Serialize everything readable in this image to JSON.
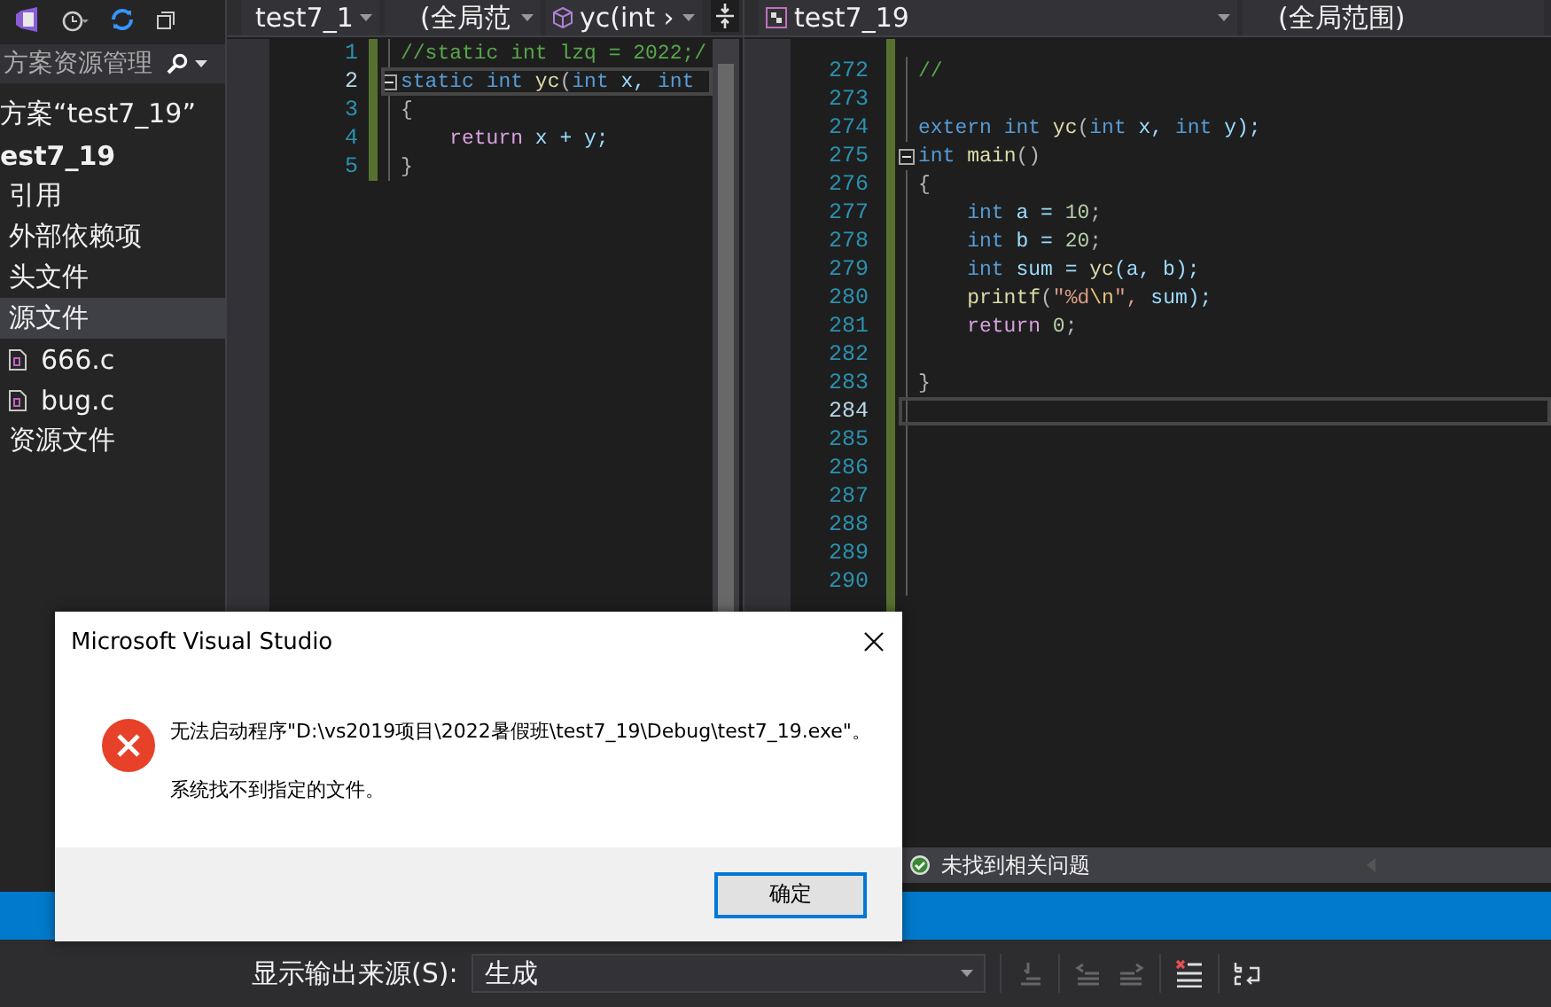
{
  "solution_explorer": {
    "search": {
      "placeholder": "方案资源管理"
    },
    "tree": [
      {
        "label": "方案“test7_19”",
        "kind": "solution",
        "selected": false,
        "children": [
          {
            "label": "est7_19",
            "kind": "project",
            "selected": false,
            "children": [
              {
                "label": "引用",
                "kind": "folder",
                "selected": false
              },
              {
                "label": "外部依赖项",
                "kind": "folder",
                "selected": false
              },
              {
                "label": "头文件",
                "kind": "folder",
                "selected": false
              },
              {
                "label": "源文件",
                "kind": "folder",
                "selected": true,
                "children": [
                  {
                    "label": "666.c",
                    "kind": "file",
                    "selected": false
                  },
                  {
                    "label": "bug.c",
                    "kind": "file",
                    "selected": false
                  }
                ]
              },
              {
                "label": "资源文件",
                "kind": "folder",
                "selected": false
              }
            ]
          }
        ]
      }
    ]
  },
  "left_editor": {
    "file": "test7_1",
    "scope": "(全局范",
    "member": "yc(int ›",
    "lines": [
      {
        "number": "1",
        "fold": false,
        "current": false,
        "tokens": [
          {
            "t": "//static int lzq = 2022;/",
            "kind": "comment"
          }
        ]
      },
      {
        "number": "2",
        "fold": true,
        "current": true,
        "tokens": [
          {
            "t": "static ",
            "kind": "keyword"
          },
          {
            "t": "int ",
            "kind": "keyword"
          },
          {
            "t": "yc",
            "kind": "function"
          },
          {
            "t": "(",
            "kind": "punct"
          },
          {
            "t": "int ",
            "kind": "keyword"
          },
          {
            "t": "x, ",
            "kind": "variable"
          },
          {
            "t": "int",
            "kind": "keyword"
          }
        ]
      },
      {
        "number": "3",
        "fold": false,
        "current": false,
        "tokens": [
          {
            "t": "{",
            "kind": "punct"
          }
        ]
      },
      {
        "number": "4",
        "fold": false,
        "current": false,
        "tokens": [
          {
            "t": "    return ",
            "kind": "control"
          },
          {
            "t": "x + y;",
            "kind": "variable"
          }
        ]
      },
      {
        "number": "5",
        "fold": false,
        "current": false,
        "tokens": [
          {
            "t": "}",
            "kind": "punct"
          }
        ]
      }
    ]
  },
  "right_editor": {
    "file": "test7_19",
    "scope": "(全局范围)",
    "lines": [
      {
        "number": "272",
        "fold": false,
        "current": false,
        "tokens": [
          {
            "t": "//",
            "kind": "comment"
          }
        ]
      },
      {
        "number": "273",
        "fold": false,
        "current": false
      },
      {
        "number": "274",
        "fold": false,
        "current": false,
        "tokens": [
          {
            "t": "extern ",
            "kind": "keyword"
          },
          {
            "t": "int ",
            "kind": "keyword"
          },
          {
            "t": "yc",
            "kind": "function"
          },
          {
            "t": "(",
            "kind": "punct"
          },
          {
            "t": "int ",
            "kind": "keyword"
          },
          {
            "t": "x, ",
            "kind": "variable"
          },
          {
            "t": "int ",
            "kind": "keyword"
          },
          {
            "t": "y);",
            "kind": "variable"
          }
        ]
      },
      {
        "number": "275",
        "fold": true,
        "current": false,
        "tokens": [
          {
            "t": "int ",
            "kind": "keyword"
          },
          {
            "t": "main",
            "kind": "function"
          },
          {
            "t": "()",
            "kind": "punct"
          }
        ]
      },
      {
        "number": "276",
        "fold": false,
        "current": false,
        "tokens": [
          {
            "t": "{",
            "kind": "punct"
          }
        ]
      },
      {
        "number": "277",
        "fold": false,
        "current": false,
        "tokens": [
          {
            "t": "    int ",
            "kind": "keyword"
          },
          {
            "t": "a = ",
            "kind": "variable"
          },
          {
            "t": "10",
            "kind": "number"
          },
          {
            "t": ";",
            "kind": "punct"
          }
        ]
      },
      {
        "number": "278",
        "fold": false,
        "current": false,
        "tokens": [
          {
            "t": "    int ",
            "kind": "keyword"
          },
          {
            "t": "b = ",
            "kind": "variable"
          },
          {
            "t": "20",
            "kind": "number"
          },
          {
            "t": ";",
            "kind": "punct"
          }
        ]
      },
      {
        "number": "279",
        "fold": false,
        "current": false,
        "tokens": [
          {
            "t": "    int ",
            "kind": "keyword"
          },
          {
            "t": "sum = ",
            "kind": "variable"
          },
          {
            "t": "yc",
            "kind": "function"
          },
          {
            "t": "(a, b);",
            "kind": "variable"
          }
        ]
      },
      {
        "number": "280",
        "fold": false,
        "current": false,
        "tokens": [
          {
            "t": "    printf",
            "kind": "function"
          },
          {
            "t": "(",
            "kind": "punct"
          },
          {
            "t": "\"%d",
            "kind": "string"
          },
          {
            "t": "\\n",
            "kind": "escape"
          },
          {
            "t": "\", ",
            "kind": "string"
          },
          {
            "t": "sum);",
            "kind": "variable"
          }
        ]
      },
      {
        "number": "281",
        "fold": false,
        "current": false,
        "tokens": [
          {
            "t": "    return ",
            "kind": "control"
          },
          {
            "t": "0",
            "kind": "number"
          },
          {
            "t": ";",
            "kind": "punct"
          }
        ]
      },
      {
        "number": "282",
        "fold": false,
        "current": false
      },
      {
        "number": "283",
        "fold": false,
        "current": false,
        "tokens": [
          {
            "t": "}",
            "kind": "punct"
          }
        ]
      },
      {
        "number": "284",
        "fold": false,
        "current": true
      },
      {
        "number": "285",
        "fold": false,
        "current": false
      },
      {
        "number": "286",
        "fold": false,
        "current": false
      },
      {
        "number": "287",
        "fold": false,
        "current": false
      },
      {
        "number": "288",
        "fold": false,
        "current": false
      },
      {
        "number": "289",
        "fold": false,
        "current": false
      },
      {
        "number": "290",
        "fold": false,
        "current": false
      }
    ],
    "status": "未找到相关问题"
  },
  "output": {
    "source_label": "显示输出来源(S):",
    "source_value": "生成"
  },
  "dialog": {
    "title": "Microsoft Visual Studio",
    "message": "无法启动程序\"D:\\vs2019项目\\2022暑假班\\test7_19\\Debug\\test7_19.exe\"。",
    "detail": "系统找不到指定的文件。",
    "button": "确定"
  }
}
